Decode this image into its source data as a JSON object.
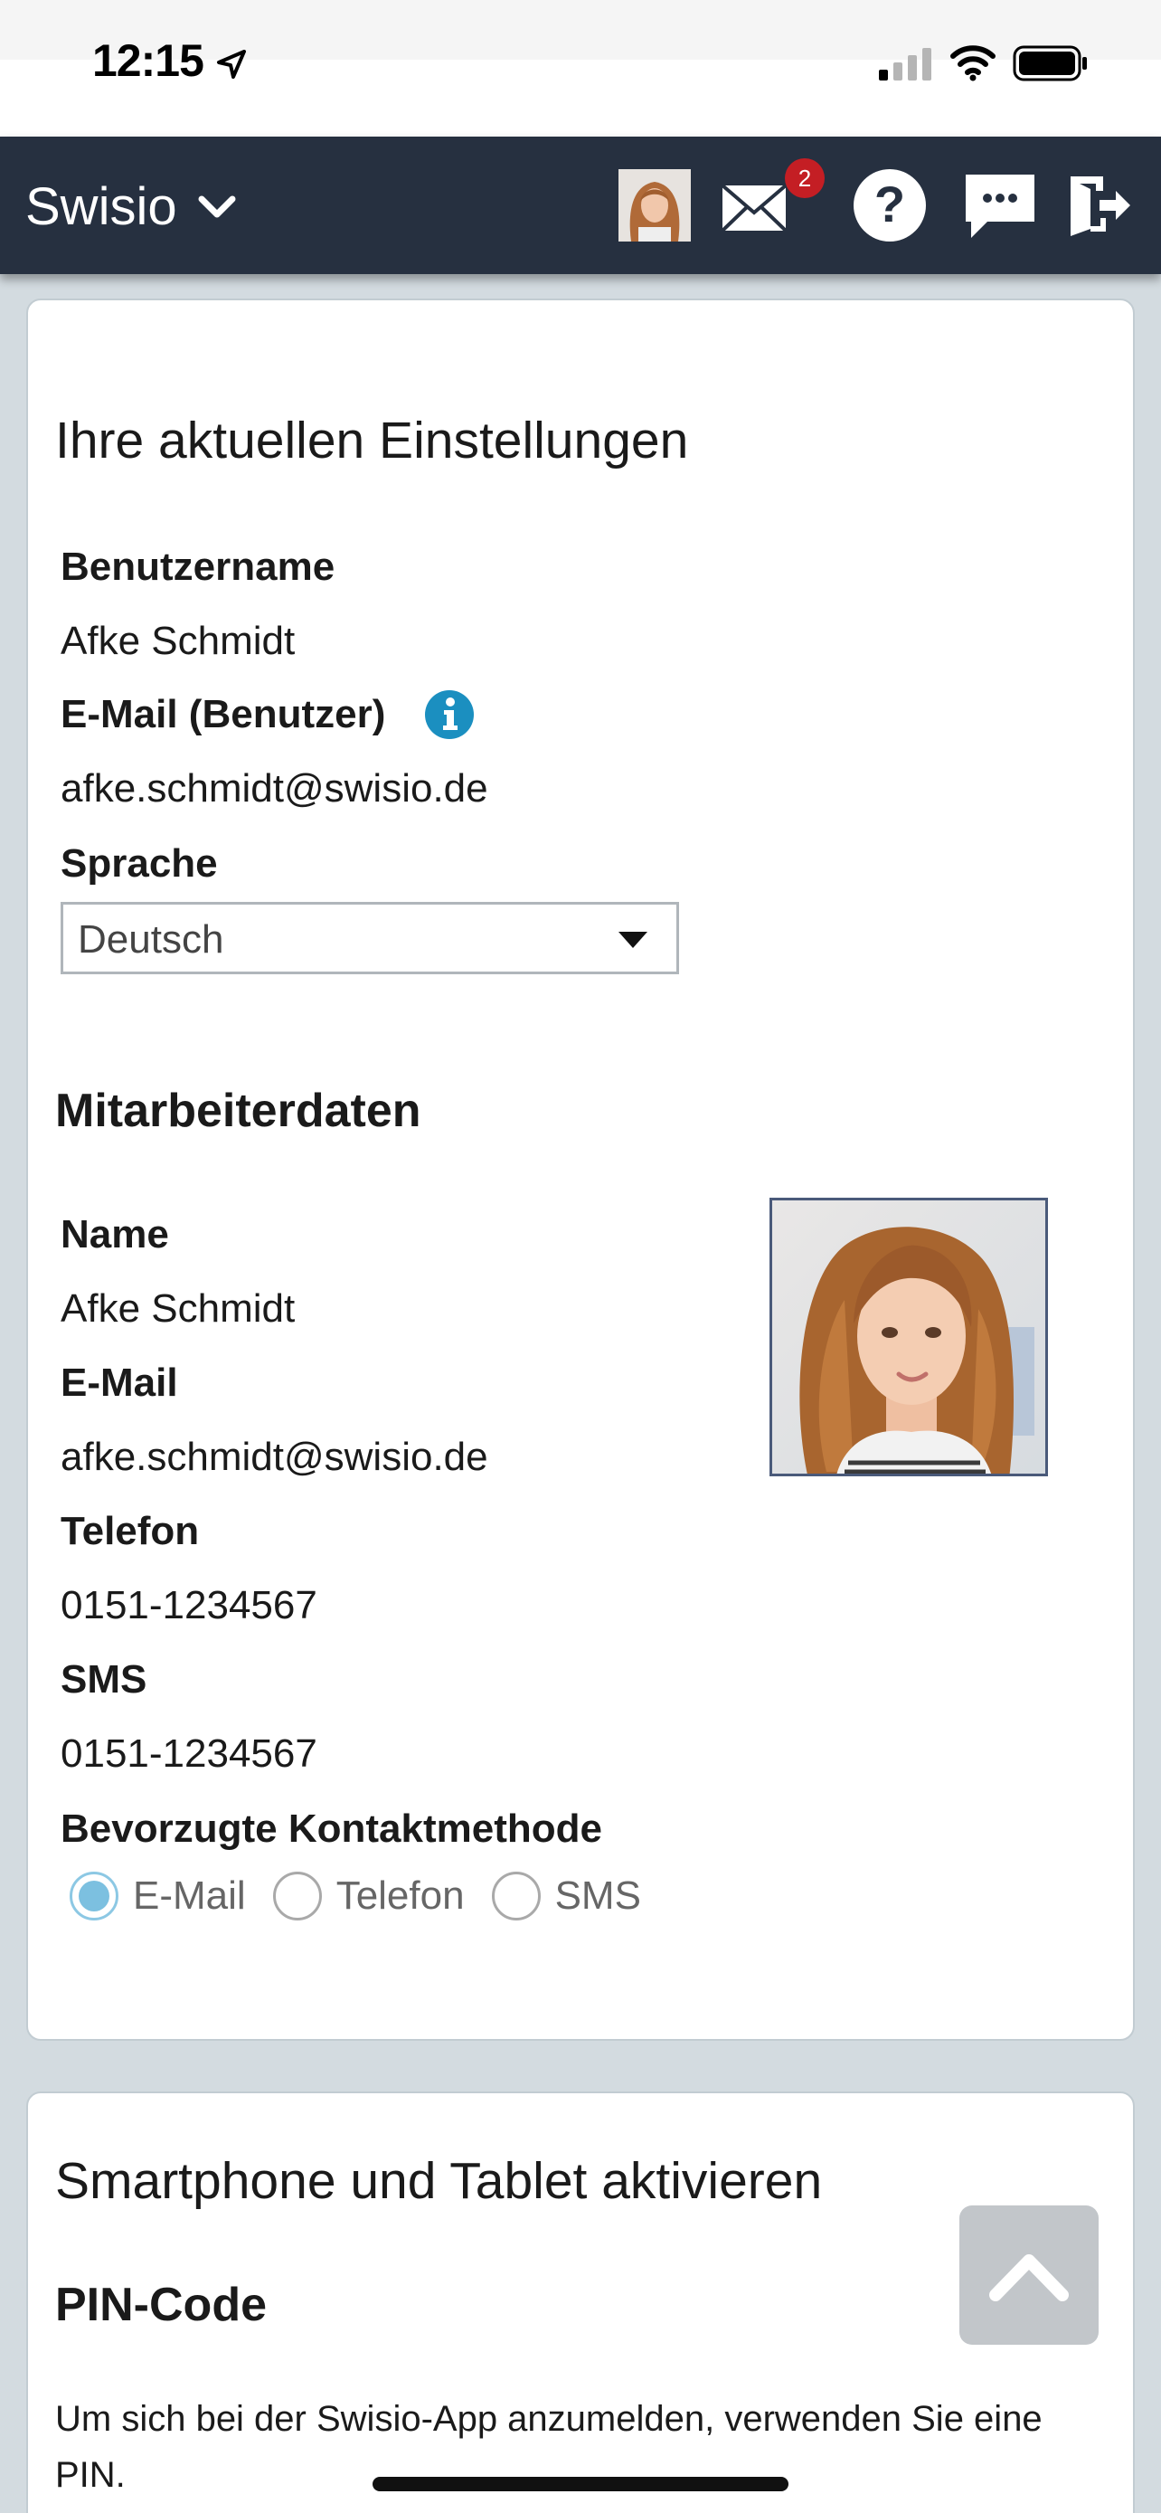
{
  "status_bar": {
    "time": "12:15"
  },
  "header": {
    "brand": "Swisio",
    "mail_badge": "2"
  },
  "settings": {
    "title": "Ihre aktuellen Einstellungen",
    "username_label": "Benutzername",
    "username_value": "Afke Schmidt",
    "user_email_label": "E-Mail (Benutzer)",
    "user_email_value": "afke.schmidt@swisio.de",
    "language_label": "Sprache",
    "language_selected": "Deutsch"
  },
  "employee": {
    "title": "Mitarbeiterdaten",
    "name_label": "Name",
    "name_value": "Afke Schmidt",
    "email_label": "E-Mail",
    "email_value": "afke.schmidt@swisio.de",
    "phone_label": "Telefon",
    "phone_value": "0151-1234567",
    "sms_label": "SMS",
    "sms_value": "0151-1234567",
    "contact_label": "Bevorzugte Kontaktmethode",
    "contact_options": [
      "E-Mail",
      "Telefon",
      "SMS"
    ],
    "contact_selected": "E-Mail"
  },
  "devices": {
    "title": "Smartphone und Tablet aktivieren",
    "pin_title": "PIN-Code",
    "pin_text": "Um sich bei der Swisio-App anzumelden, verwenden Sie eine PIN."
  },
  "colors": {
    "header_bg": "#263040",
    "badge": "#c41e24",
    "info_icon": "#1b8fc0",
    "radio_selected": "#7cc0e0"
  },
  "icons": [
    "location-arrow-icon",
    "signal-icon",
    "wifi-icon",
    "battery-icon",
    "chevron-down-icon",
    "mail-icon",
    "help-icon",
    "chat-icon",
    "logout-icon",
    "info-icon",
    "caret-down-icon",
    "chevron-up-icon"
  ]
}
